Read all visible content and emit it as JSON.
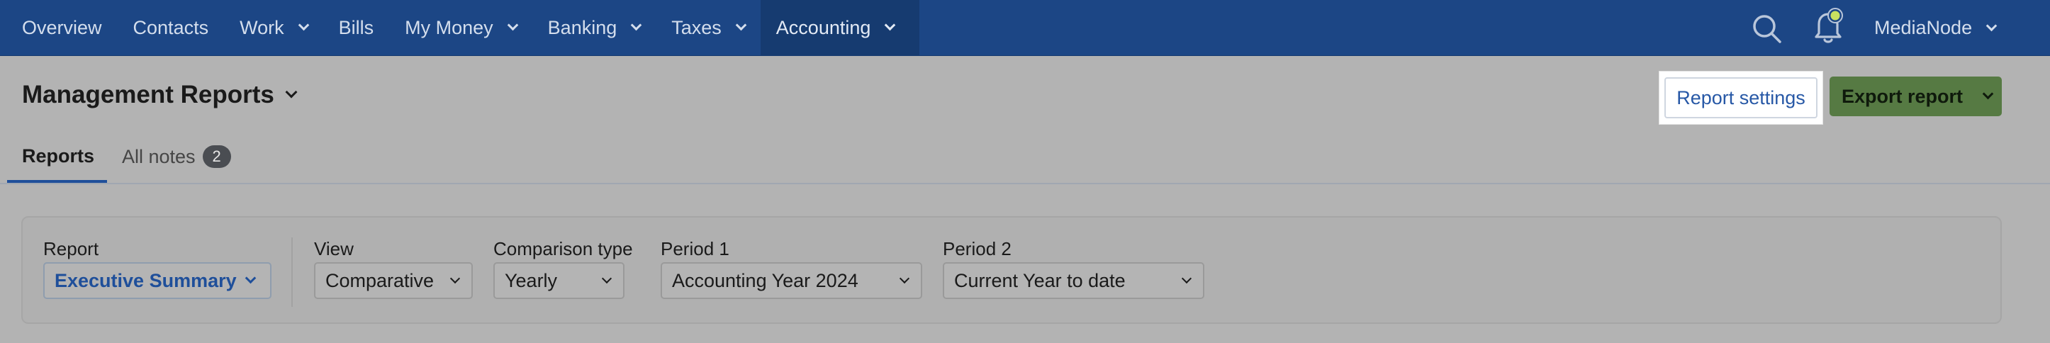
{
  "nav": {
    "items": [
      {
        "label": "Overview",
        "dropdown": false
      },
      {
        "label": "Contacts",
        "dropdown": false
      },
      {
        "label": "Work",
        "dropdown": true
      },
      {
        "label": "Bills",
        "dropdown": false
      },
      {
        "label": "My Money",
        "dropdown": true
      },
      {
        "label": "Banking",
        "dropdown": true
      },
      {
        "label": "Taxes",
        "dropdown": true
      },
      {
        "label": "Accounting",
        "dropdown": true,
        "active": true
      }
    ],
    "account": "MediaNode"
  },
  "header": {
    "title": "Management Reports",
    "settings_label": "Report settings",
    "export_label": "Export report"
  },
  "tabs": {
    "reports": "Reports",
    "notes": "All notes",
    "notes_count": "2"
  },
  "filters": {
    "report": {
      "label": "Report",
      "value": "Executive Summary"
    },
    "view": {
      "label": "View",
      "value": "Comparative"
    },
    "comparison": {
      "label": "Comparison type",
      "value": "Yearly"
    },
    "period1": {
      "label": "Period 1",
      "value": "Accounting Year 2024"
    },
    "period2": {
      "label": "Period 2",
      "value": "Current Year to date"
    }
  },
  "colors": {
    "nav_bg": "#1c4685",
    "accent": "#1f4f9a",
    "export_bg": "#567a43",
    "bell_dot": "#c8e060"
  }
}
